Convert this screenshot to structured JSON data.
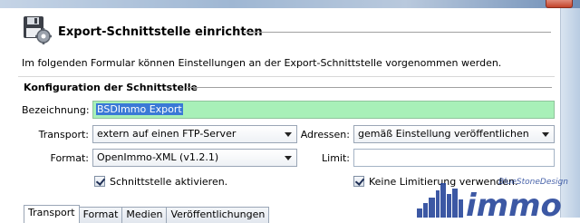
{
  "header": {
    "title": "Export-Schnittstelle einrichten",
    "intro": "Im folgenden Formular können Einstellungen an der Export-Schnittstelle vorgenommen werden."
  },
  "section": {
    "title": "Konfiguration der Schnittstelle"
  },
  "form": {
    "bezeichnung_label": "Bezeichnung:",
    "bezeichnung_value": "BSDImmo Export",
    "transport_label": "Transport:",
    "transport_value": "extern auf einen FTP-Server",
    "adressen_label": "Adressen:",
    "adressen_value": "gemäß Einstellung veröffentlichen",
    "format_label": "Format:",
    "format_value": "OpenImmo-XML (v1.2.1)",
    "limit_label": "Limit:",
    "limit_value": "",
    "aktivieren_label": "Schnittstelle aktivieren.",
    "aktivieren_checked": true,
    "limitierung_label": "Keine Limitierung verwenden.",
    "limitierung_checked": true
  },
  "tabs": [
    {
      "label": "Transport",
      "active": true
    },
    {
      "label": "Format",
      "active": false
    },
    {
      "label": "Medien",
      "active": false
    },
    {
      "label": "Veröffentlichungen",
      "active": false
    }
  ],
  "watermark": {
    "logo_text": "BlueStoneDesign",
    "word_text": "immo"
  },
  "colors": {
    "highlight_field": "#a8f0b8",
    "selection": "#3a79d6",
    "brand_blue": "#27479b"
  },
  "icons": {
    "header_icon": "floppy-gear-icon"
  }
}
